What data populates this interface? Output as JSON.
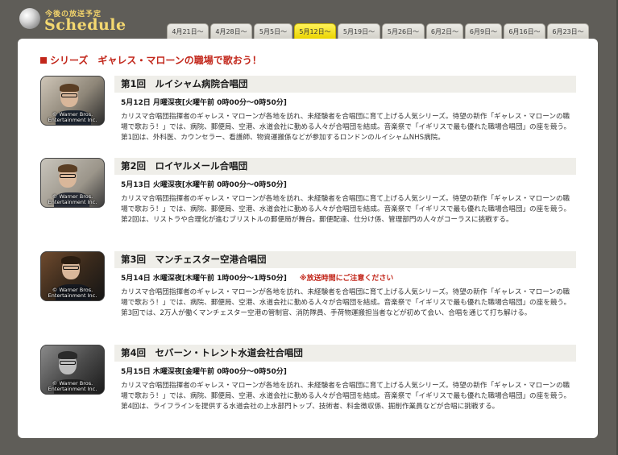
{
  "header": {
    "logo_small": "今後の放送予定",
    "logo_big": "Schedule"
  },
  "tabs": [
    {
      "label": "4月21日～",
      "active": false
    },
    {
      "label": "4月28日～",
      "active": false
    },
    {
      "label": "5月5日～",
      "active": false
    },
    {
      "label": "5月12日～",
      "active": true
    },
    {
      "label": "5月19日～",
      "active": false
    },
    {
      "label": "5月26日～",
      "active": false
    },
    {
      "label": "6月2日～",
      "active": false
    },
    {
      "label": "6月9日～",
      "active": false
    },
    {
      "label": "6月16日～",
      "active": false
    },
    {
      "label": "6月23日～",
      "active": false
    }
  ],
  "series_title": "シリーズ　ギャレス・マローンの職場で歌おう！",
  "thumb_credit": "© Warner Bros. Entertainment Inc.",
  "colors": {
    "accent_red": "#c2261a",
    "tab_active": "#f5e31a",
    "frame": "#5f5d58"
  },
  "episodes": [
    {
      "title": "第1回　ルイシャム病院合唱団",
      "date": "5月12日 月曜深夜[火曜午前 0時00分～0時50分]",
      "note": "",
      "desc": "カリスマ合唱団指揮者のギャレス・マローンが各地を訪れ、未経験者を合唱団に育て上げる人気シリーズ。待望の新作「ギャレス・マローンの職場で歌おう！」では、病院、郵便局、空港、水道会社に勤める人々が合唱団を結成。音楽祭で「イギリスで最も優れた職場合唱団」の座を競う。第1回は、外科医、カウンセラー、看護師、物資運搬係などが参加するロンドンのルイシャムNHS病院。"
    },
    {
      "title": "第2回　ロイヤルメール合唱団",
      "date": "5月13日 火曜深夜[水曜午前 0時00分～0時50分]",
      "note": "",
      "desc": "カリスマ合唱団指揮者のギャレス・マローンが各地を訪れ、未経験者を合唱団に育て上げる人気シリーズ。待望の新作「ギャレス・マローンの職場で歌おう！」では、病院、郵便局、空港、水道会社に勤める人々が合唱団を結成。音楽祭で「イギリスで最も優れた職場合唱団」の座を競う。第2回は、リストラや合理化が進むブリストルの郵便局が舞台。郵便配達、仕分け係、管理部門の人々がコーラスに挑戦する。"
    },
    {
      "title": "第3回　マンチェスター空港合唱団",
      "date": "5月14日 水曜深夜[木曜午前 1時00分～1時50分]",
      "note": "※放送時間にご注意ください",
      "desc": "カリスマ合唱団指揮者のギャレス・マローンが各地を訪れ、未経験者を合唱団に育て上げる人気シリーズ。待望の新作「ギャレス・マローンの職場で歌おう！」では、病院、郵便局、空港、水道会社に勤める人々が合唱団を結成。音楽祭で「イギリスで最も優れた職場合唱団」の座を競う。第3回では、2万人が働くマンチェスター空港の管制官、消防隊員、手荷物運搬担当者などが初めて会い、合唱を通じて打ち解ける。"
    },
    {
      "title": "第4回　セバーン・トレント水道会社合唱団",
      "date": "5月15日 木曜深夜[金曜午前 0時00分～0時50分]",
      "note": "",
      "desc": "カリスマ合唱団指揮者のギャレス・マローンが各地を訪れ、未経験者を合唱団に育て上げる人気シリーズ。待望の新作「ギャレス・マローンの職場で歌おう！」では、病院、郵便局、空港、水道会社に勤める人々が合唱団を結成。音楽祭で「イギリスで最も優れた職場合唱団」の座を競う。第4回は、ライフラインを提供する水道会社の上水部門トップ、技術者、料金徴収係、掘削作業員などが合唱に挑戦する。"
    }
  ]
}
